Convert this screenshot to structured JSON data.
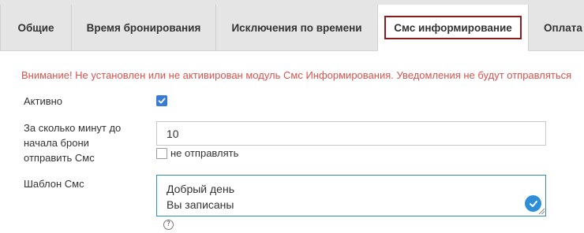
{
  "tabs": [
    {
      "label": "Общие"
    },
    {
      "label": "Время бронирования"
    },
    {
      "label": "Исключения по времени"
    },
    {
      "label": "Смс информирование"
    },
    {
      "label": "Оплата"
    }
  ],
  "active_tab": "Смс информирование",
  "warning": "Внимание! Не установлен или не активирован модуль Смс Информирования. Уведомления не будут отправляться",
  "form": {
    "active": {
      "label": "Активно",
      "checked": true
    },
    "minutes": {
      "label_lines": [
        "За сколько минут до",
        "начала брони",
        "отправить Смс"
      ],
      "value": "10",
      "dont_send_label": "не отправлять",
      "dont_send_checked": false
    },
    "template": {
      "label": "Шаблон Смс",
      "lines": [
        "Добрый день",
        "Вы записаны"
      ]
    },
    "help_icon": "question-circle-icon"
  },
  "colors": {
    "warning": "#d9534f",
    "checkbox": "#3a7bd5",
    "active_tab_outline": "#8b1c1c",
    "textarea_border": "#2e8eb8"
  }
}
